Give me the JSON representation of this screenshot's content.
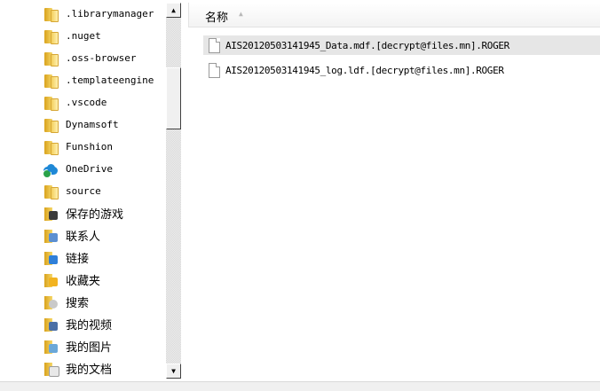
{
  "tree": {
    "items": [
      {
        "label": ".librarymanager",
        "icon": "folder-icon"
      },
      {
        "label": ".nuget",
        "icon": "folder-icon"
      },
      {
        "label": ".oss-browser",
        "icon": "folder-icon"
      },
      {
        "label": ".templateengine",
        "icon": "folder-icon"
      },
      {
        "label": ".vscode",
        "icon": "folder-icon"
      },
      {
        "label": "Dynamsoft",
        "icon": "folder-icon"
      },
      {
        "label": "Funshion",
        "icon": "folder-icon"
      },
      {
        "label": "OneDrive",
        "icon": "onedrive-cloud-icon"
      },
      {
        "label": "source",
        "icon": "folder-icon"
      },
      {
        "label": "保存的游戏",
        "icon": "saved-games-icon"
      },
      {
        "label": "联系人",
        "icon": "contacts-icon"
      },
      {
        "label": "链接",
        "icon": "links-icon"
      },
      {
        "label": "收藏夹",
        "icon": "favorites-icon"
      },
      {
        "label": "搜索",
        "icon": "searches-icon"
      },
      {
        "label": "我的视频",
        "icon": "my-videos-icon"
      },
      {
        "label": "我的图片",
        "icon": "my-pictures-icon"
      },
      {
        "label": "我的文档",
        "icon": "my-documents-icon"
      }
    ]
  },
  "scrollbar": {
    "up_glyph": "▲",
    "down_glyph": "▼"
  },
  "main": {
    "column_header": "名称",
    "sort_glyph": "▲",
    "files": [
      {
        "name": "AIS20120503141945_Data.mdf.[decrypt@files.mn].ROGER",
        "selected": true,
        "icon": "file-icon"
      },
      {
        "name": "AIS20120503141945_log.ldf.[decrypt@files.mn].ROGER",
        "selected": false,
        "icon": "file-icon"
      }
    ]
  },
  "colors": {
    "selection": "#e6e6e6",
    "folder": "#f6d86a",
    "onedrive": "#1e88d6"
  }
}
